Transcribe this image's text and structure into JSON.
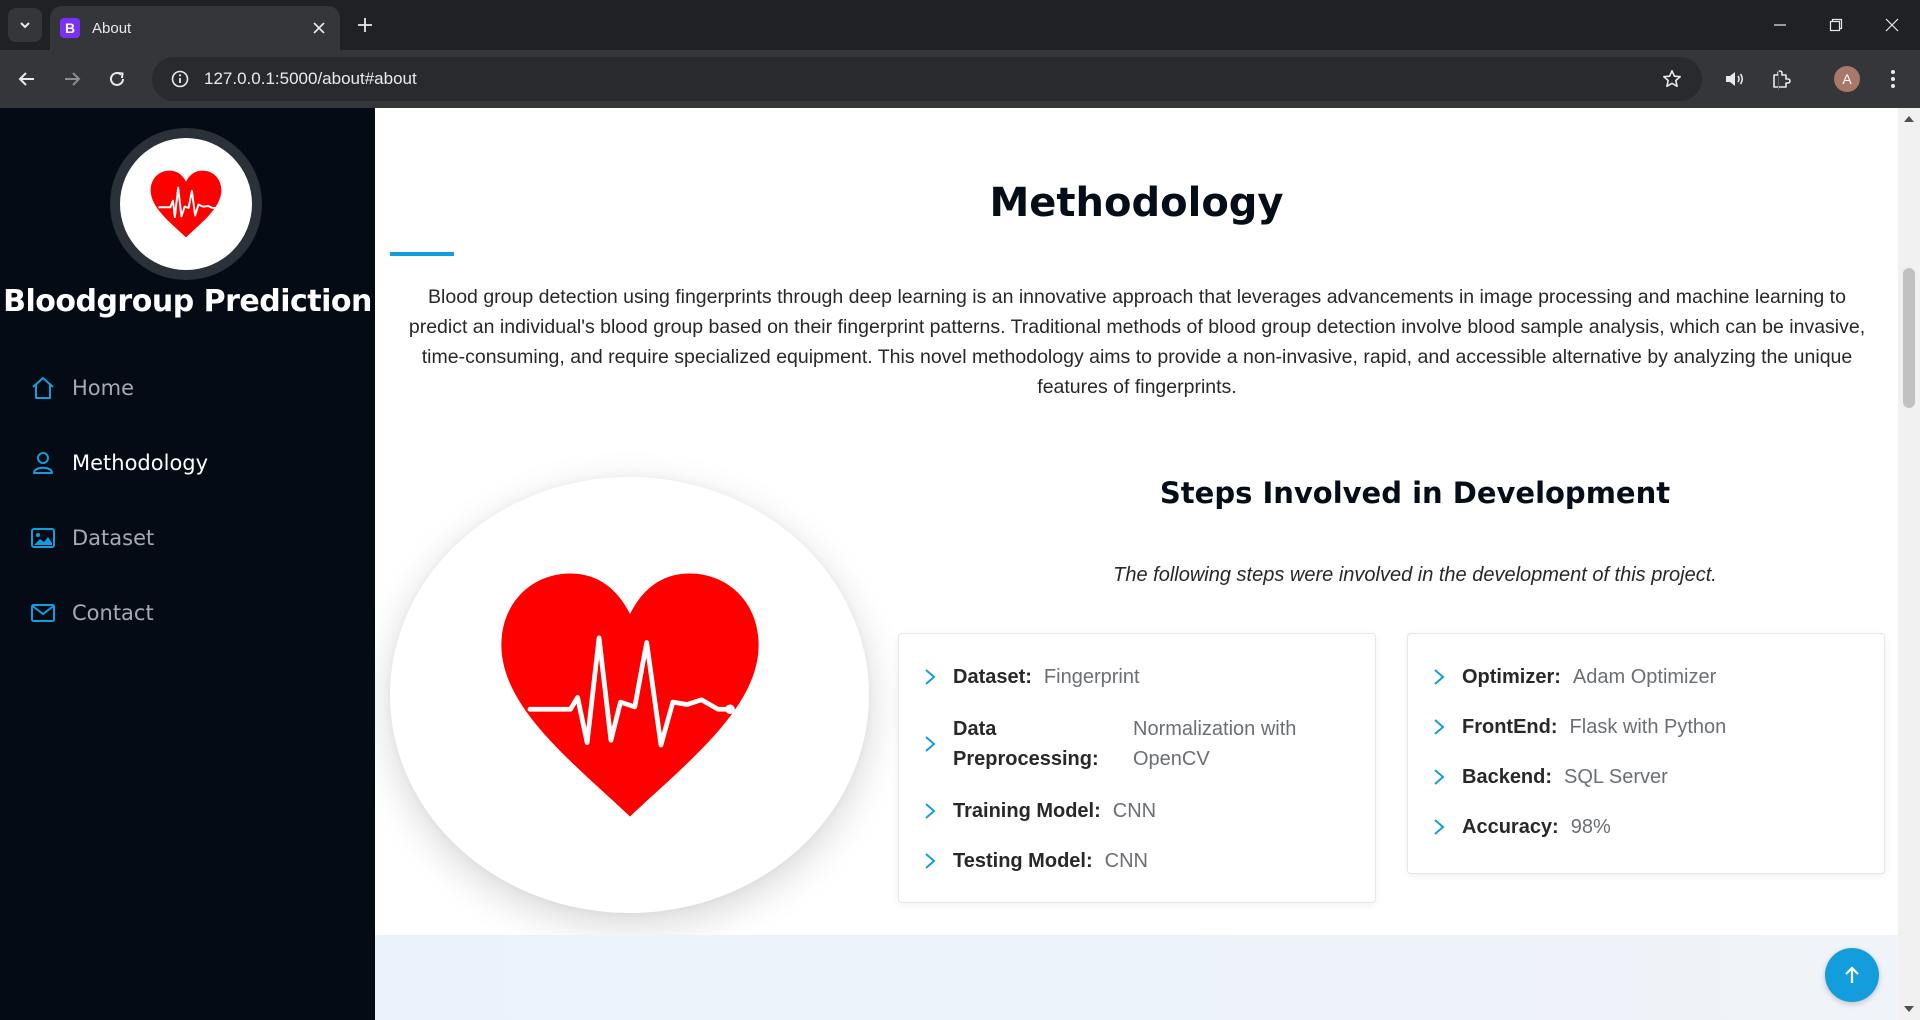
{
  "browser": {
    "tab_title": "About",
    "tab_favicon_letter": "B",
    "url": "127.0.0.1:5000/about#about",
    "profile_initial": "A"
  },
  "sidebar": {
    "title": "Bloodgroup Prediction",
    "items": [
      {
        "label": "Home",
        "icon": "house-icon",
        "active": false
      },
      {
        "label": "Methodology",
        "icon": "person-icon",
        "active": true
      },
      {
        "label": "Dataset",
        "icon": "images-icon",
        "active": false
      },
      {
        "label": "Contact",
        "icon": "envelope-icon",
        "active": false
      }
    ]
  },
  "main": {
    "section_title": "Methodology",
    "intro": "Blood group detection using fingerprints through deep learning is an innovative approach that leverages advancements in image processing and machine learning to predict an individual's blood group based on their fingerprint patterns. Traditional methods of blood group detection involve blood sample analysis, which can be invasive, time-consuming, and require specialized equipment. This novel methodology aims to provide a non-invasive, rapid, and accessible alternative by analyzing the unique features of fingerprints.",
    "steps_title": "Steps Involved in Development",
    "steps_subtitle": "The following steps were involved in the development of this project.",
    "left_list": [
      {
        "key": "Dataset:",
        "value": "Fingerprint"
      },
      {
        "key": "Data Preprocessing:",
        "value": "Normalization with OpenCV"
      },
      {
        "key": "Training Model:",
        "value": "CNN"
      },
      {
        "key": "Testing Model:",
        "value": "CNN"
      }
    ],
    "right_list": [
      {
        "key": "Optimizer:",
        "value": "Adam Optimizer"
      },
      {
        "key": "FrontEnd:",
        "value": "Flask with Python"
      },
      {
        "key": "Backend:",
        "value": "SQL Server"
      },
      {
        "key": "Accuracy:",
        "value": "98%"
      }
    ]
  },
  "colors": {
    "accent": "#149ddd",
    "sidebar_bg": "#040b14",
    "heart": "#ff0000"
  }
}
